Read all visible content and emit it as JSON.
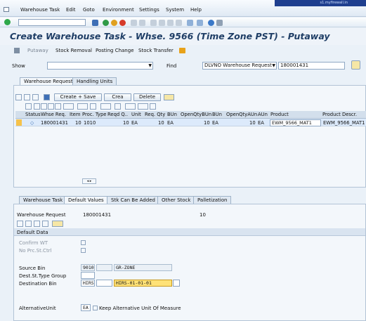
{
  "menu": [
    "Warehouse Task",
    "Edit",
    "Goto",
    "Environment",
    "Settings",
    "System",
    "Help"
  ],
  "user_bar": "s1.myfirewall.in",
  "title": "Create Warehouse Task - Whse. 9566 (Time Zone PST) - Putaway",
  "app_toolbar": [
    "Putaway",
    "Stock Removal",
    "Posting Change",
    "Stock Transfer"
  ],
  "show_label": "Show",
  "find_label": "Find",
  "find_select": "DLVNO Warehouse Request",
  "find_value": "180001431",
  "top_tabs": [
    "Warehouse Request",
    "Handling Units"
  ],
  "grid_buttons": {
    "create_save": "Create + Save",
    "create": "Crea",
    "delete": "Delete"
  },
  "grid_columns": [
    "Status",
    "Whse Req.",
    "Item",
    "Proc. Type",
    "Reqd Q..",
    "Unit",
    "Req. Qty",
    "BUn",
    "OpenQtyBUn",
    "BUn",
    "OpenQtyAUn",
    "AUn",
    "Product",
    "Product Descr."
  ],
  "grid_row": {
    "status": "◇",
    "whse_req": "180001431",
    "item": "10",
    "proc_type": "1010",
    "reqd_q": "10",
    "unit": "EA",
    "req_qty": "10",
    "bun": "EA",
    "open_qty_bun": "10",
    "bun2": "EA",
    "open_qty_aun": "10",
    "aun": "EA",
    "product": "EWM_9566_MAT1",
    "product_descr": "EWM_9566_MAT1"
  },
  "bottom_tabs": [
    "Warehouse Task",
    "Default Values",
    "Stk Can Be Added",
    "Other Stock",
    "Palletization"
  ],
  "warehouse_request_label": "Warehouse Request",
  "warehouse_request_value": "180001431",
  "warehouse_request_item": "10",
  "default_data_header": "Default Data",
  "confirm_wt_label": "Confirm WT",
  "no_prc_st_ctrl_label": "No Prc.St.Ctrl",
  "source_bin_label": "Source Bin",
  "source_bin_type": "9010",
  "source_bin_value": "GR-ZONE",
  "dest_st_type_group_label": "Dest.St.Type Group",
  "destination_bin_label": "Destination Bin",
  "destination_bin_type": "HIRS",
  "destination_bin_value": "HIRS-01-01-01",
  "alternative_unit_label": "AlternativeUnit",
  "alternative_unit_value": "EA",
  "keep_alt_unit_label": "Keep Alternative Unit Of Measure",
  "colors": {
    "title": "#1f3e66",
    "highlight": "#ffe277",
    "selected_row": "#dceafb"
  },
  "icons": [
    "menu-icon",
    "check-icon",
    "save-icon",
    "back-icon",
    "exit-icon",
    "cancel-icon",
    "print-icon",
    "find-icon",
    "new-session-icon",
    "help-icon",
    "transfer-icon"
  ]
}
